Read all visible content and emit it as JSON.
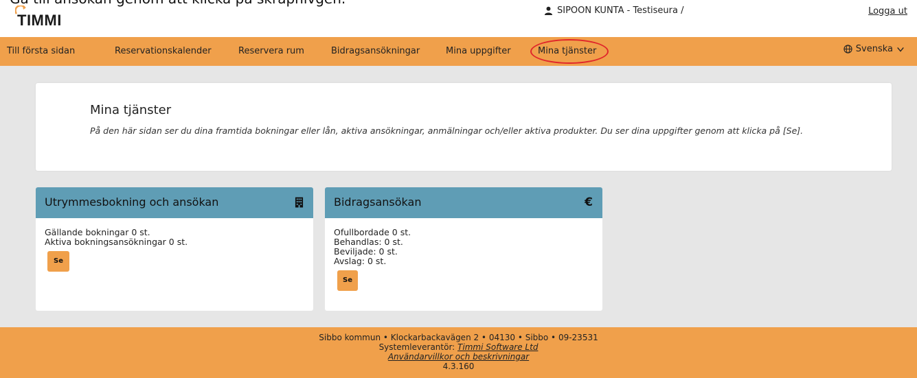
{
  "overlay_text": "Gå till ansökan genom att klicka på skrapnivgen.",
  "brand": {
    "name": "TIMMI"
  },
  "header": {
    "user": "SIPOON KUNTA - Testiseura /",
    "logout": "Logga ut"
  },
  "nav": {
    "items": [
      {
        "label": "Till första sidan"
      },
      {
        "label": "Reservationskalender"
      },
      {
        "label": "Reservera rum"
      },
      {
        "label": "Bidragsansökningar"
      },
      {
        "label": "Mina uppgifter"
      },
      {
        "label": "Mina tjänster"
      }
    ],
    "language": "Svenska"
  },
  "intro": {
    "title": "Mina tjänster",
    "text": "På den här sidan ser du dina framtida bokningar eller lån, aktiva ansökningar, anmälningar och/eller aktiva produkter. Du ser dina uppgifter genom att klicka på [Se]."
  },
  "cards": [
    {
      "title": "Utrymmesbokning och ansökan",
      "icon": "building-icon",
      "lines": [
        "Gällande bokningar 0 st.",
        "Aktiva bokningsansökningar 0 st."
      ],
      "button": "Se"
    },
    {
      "title": "Bidragsansökan",
      "icon": "euro-icon",
      "lines": [
        "Ofullbordade 0 st.",
        "Behandlas: 0 st.",
        "Beviljade: 0 st.",
        "Avslag: 0 st."
      ],
      "button": "Se"
    }
  ],
  "footer": {
    "address": "Sibbo kommun • Klockarbackavägen 2 • 04130 • Sibbo • 09-23531",
    "supplier_label": "Systemleverantör:",
    "supplier_link": "Timmi Software Ltd",
    "terms_link": "Användarvillkor och beskrivningar",
    "version": "4.3.160"
  },
  "colors": {
    "orange": "#f0a04b",
    "card_header": "#5f9db5",
    "background": "#e6e6e6",
    "highlight_circle": "#e0262b"
  }
}
